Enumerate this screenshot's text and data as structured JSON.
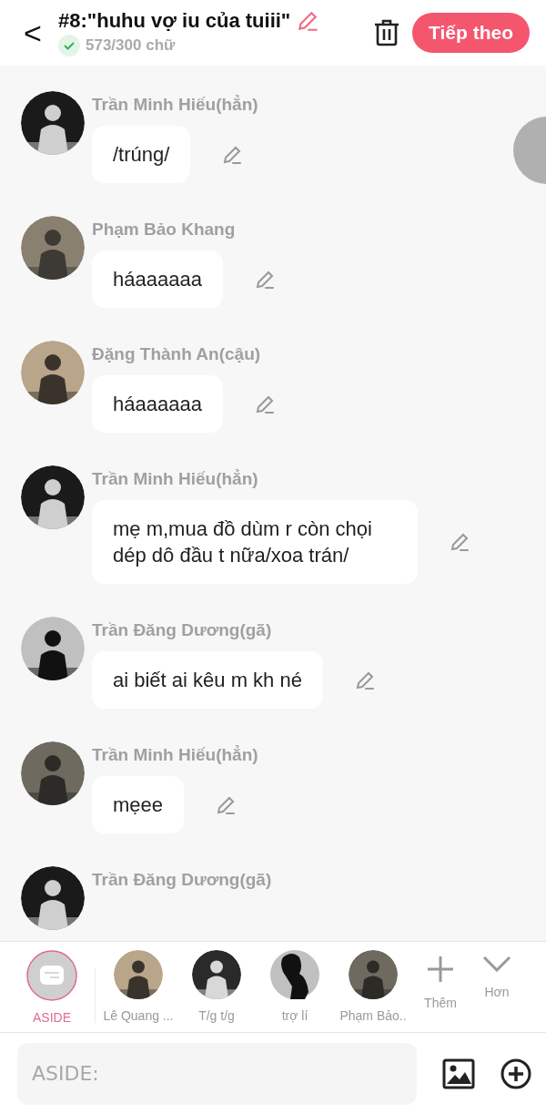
{
  "header": {
    "back": "<",
    "title": "#8:\"huhu vợ iu của tuiii\"",
    "count_ok": true,
    "count": "573/300 chữ",
    "next_button": "Tiếp theo"
  },
  "messages": [
    {
      "name": "Trần Minh Hiếu(hẳn)",
      "text": "/trúng/"
    },
    {
      "name": "Phạm Bảo Khang",
      "text": "háaaaaaa"
    },
    {
      "name": "Đặng Thành An(cậu)",
      "text": "háaaaaaa"
    },
    {
      "name": "Trần Minh Hiếu(hẳn)",
      "text": "mẹ m,mua đồ dùm r còn chọi dép dô đầu t nữa/xoa trán/"
    },
    {
      "name": "Trần Đăng Dương(gã)",
      "text": "ai biết ai kêu m kh né"
    },
    {
      "name": "Trần Minh Hiếu(hẳn)",
      "text": "mẹee"
    },
    {
      "name": "Trần Đăng Dương(gã)"
    }
  ],
  "characters": [
    {
      "kind": "aside",
      "label": "ASIDE",
      "selected": true
    },
    {
      "kind": "avatar",
      "label": "Lê Quang ...",
      "selected": false
    },
    {
      "kind": "avatar",
      "label": "T/g t/g",
      "selected": false
    },
    {
      "kind": "silhouette",
      "label": "trợ lí",
      "selected": false
    },
    {
      "kind": "avatar",
      "label": "Phạm Bảo..",
      "selected": false
    }
  ],
  "actions": [
    {
      "kind": "add",
      "label": "Thêm"
    },
    {
      "kind": "more",
      "label": "Hơn"
    }
  ],
  "input": {
    "placeholder": "ASIDE:"
  }
}
